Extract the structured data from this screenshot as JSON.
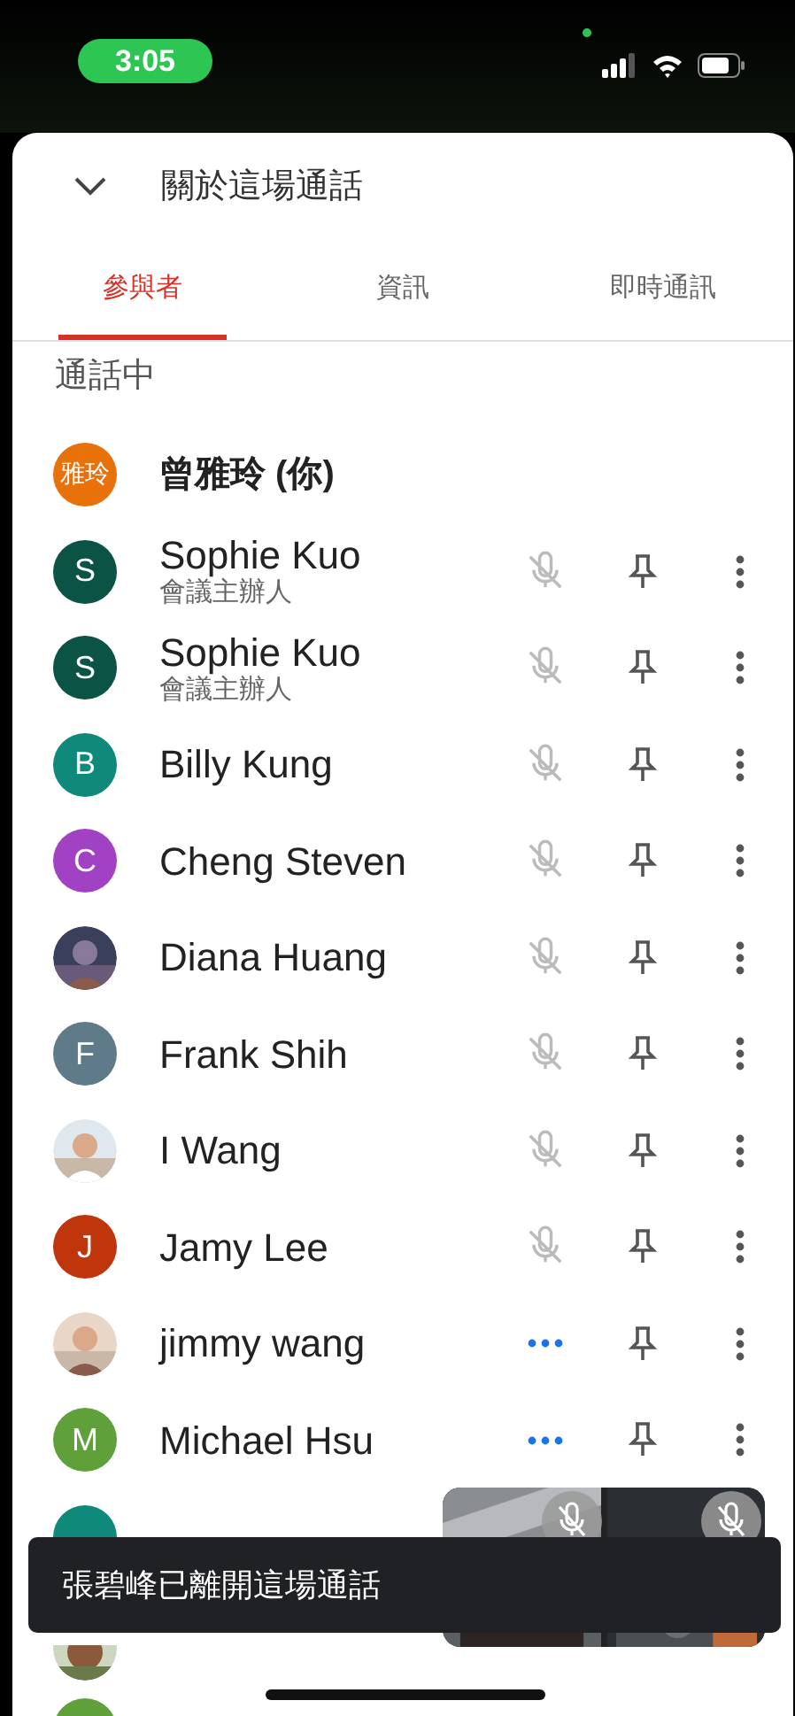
{
  "status_bar": {
    "time": "3:05"
  },
  "header": {
    "title": "關於這場通話"
  },
  "tabs": [
    {
      "label": "參與者",
      "selected": true
    },
    {
      "label": "資訊",
      "selected": false
    },
    {
      "label": "即時通訊",
      "selected": false
    }
  ],
  "section": {
    "title": "通話中"
  },
  "participants": [
    {
      "name": "曾雅玲 (你)",
      "avatar": {
        "kind": "letter",
        "text": "雅玲",
        "color": "#e8710a"
      },
      "self": true
    },
    {
      "name": "Sophie Kuo",
      "role": "會議主辦人",
      "avatar": {
        "kind": "letter",
        "text": "S",
        "color": "#0b5345"
      },
      "muted": true
    },
    {
      "name": "Sophie Kuo",
      "role": "會議主辦人",
      "avatar": {
        "kind": "letter",
        "text": "S",
        "color": "#0b5345"
      },
      "muted": true
    },
    {
      "name": "Billy Kung",
      "avatar": {
        "kind": "letter",
        "text": "B",
        "color": "#0f8a7a"
      },
      "muted": true
    },
    {
      "name": "Cheng Steven",
      "avatar": {
        "kind": "letter",
        "text": "C",
        "color": "#a142c4"
      },
      "muted": true
    },
    {
      "name": "Diana Huang",
      "muted": true
    },
    {
      "name": "Frank Shih",
      "avatar": {
        "kind": "letter",
        "text": "F",
        "color": "#5f7b8a"
      },
      "muted": true
    },
    {
      "name": "I Wang",
      "muted": true
    },
    {
      "name": "Jamy Lee",
      "avatar": {
        "kind": "letter",
        "text": "J",
        "color": "#c0360c"
      },
      "muted": true
    },
    {
      "name": "jimmy wang",
      "muted": false
    },
    {
      "name": "Michael Hsu",
      "avatar": {
        "kind": "letter",
        "text": "M",
        "color": "#5fa03a"
      },
      "muted": false
    }
  ],
  "toast": {
    "text": "張碧峰已離開這場通話"
  }
}
